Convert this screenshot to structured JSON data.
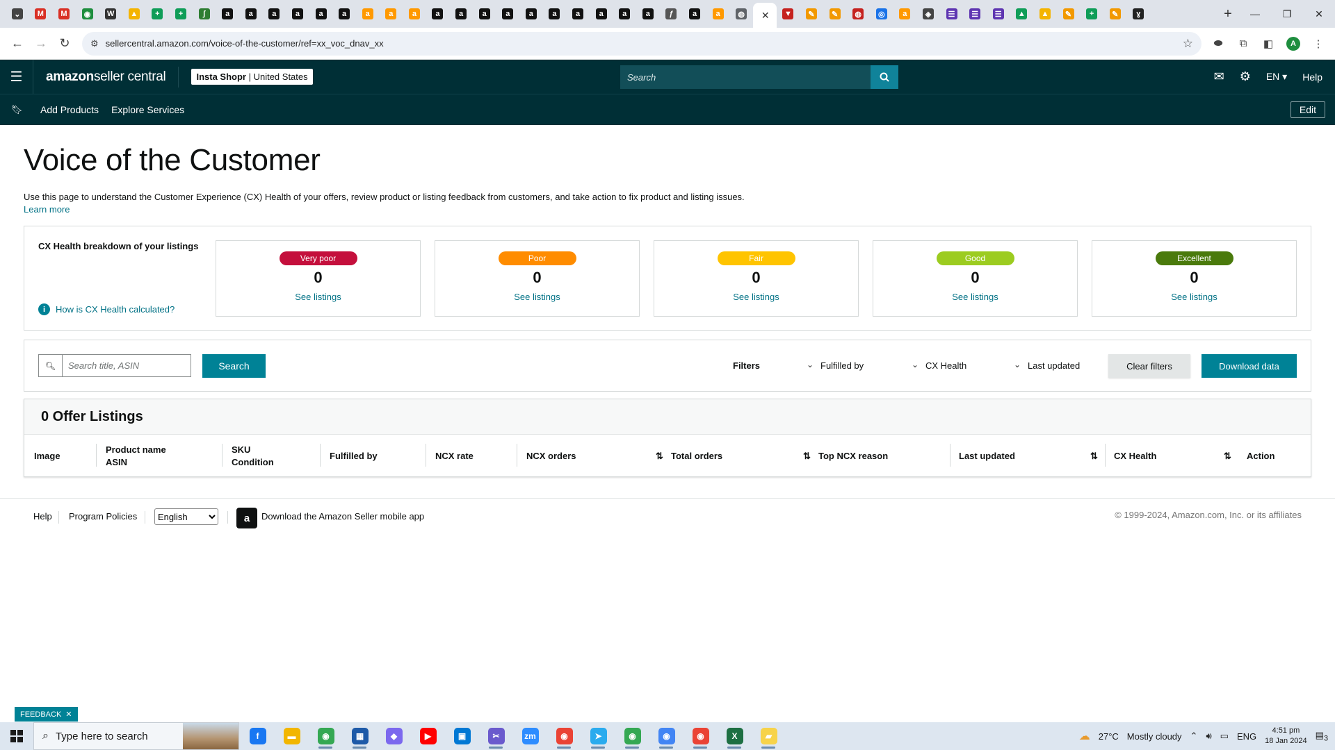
{
  "browser": {
    "tab_favicons": [
      {
        "icon": "chevron-down-icon",
        "glyph": "⌄",
        "color": "#444444"
      },
      {
        "icon": "gmail-icon",
        "glyph": "M",
        "color": "#d93025"
      },
      {
        "icon": "gmail-icon",
        "glyph": "M",
        "color": "#d93025"
      },
      {
        "icon": "app-icon",
        "glyph": "◉",
        "color": "#1e8e3e"
      },
      {
        "icon": "wix-icon",
        "glyph": "W",
        "color": "#333333"
      },
      {
        "icon": "drive-icon",
        "glyph": "▲",
        "color": "#f4b400"
      },
      {
        "icon": "sheets-icon",
        "glyph": "+",
        "color": "#0f9d58"
      },
      {
        "icon": "sheets-icon",
        "glyph": "+",
        "color": "#0f9d58"
      },
      {
        "icon": "app-icon",
        "glyph": "ʃ",
        "color": "#2e7d32"
      },
      {
        "icon": "amazon-icon",
        "glyph": "a",
        "color": "#111111"
      },
      {
        "icon": "amazon-icon",
        "glyph": "a",
        "color": "#111111"
      },
      {
        "icon": "amazon-icon",
        "glyph": "a",
        "color": "#111111"
      },
      {
        "icon": "amazon-icon",
        "glyph": "a",
        "color": "#111111"
      },
      {
        "icon": "amazon-icon",
        "glyph": "a",
        "color": "#111111"
      },
      {
        "icon": "amazon-icon",
        "glyph": "a",
        "color": "#111111"
      },
      {
        "icon": "amazon-smile-icon",
        "glyph": "a",
        "color": "#ff9900"
      },
      {
        "icon": "amazon-smile-icon",
        "glyph": "a",
        "color": "#ff9900"
      },
      {
        "icon": "amazon-smile-icon",
        "glyph": "a",
        "color": "#ff9900"
      },
      {
        "icon": "amazon-icon",
        "glyph": "a",
        "color": "#111111"
      },
      {
        "icon": "amazon-icon",
        "glyph": "a",
        "color": "#111111"
      },
      {
        "icon": "amazon-icon",
        "glyph": "a",
        "color": "#111111"
      },
      {
        "icon": "amazon-icon",
        "glyph": "a",
        "color": "#111111"
      },
      {
        "icon": "amazon-icon",
        "glyph": "a",
        "color": "#111111"
      },
      {
        "icon": "amazon-icon",
        "glyph": "a",
        "color": "#111111"
      },
      {
        "icon": "amazon-icon",
        "glyph": "a",
        "color": "#111111"
      },
      {
        "icon": "amazon-icon",
        "glyph": "a",
        "color": "#111111"
      },
      {
        "icon": "amazon-icon",
        "glyph": "a",
        "color": "#111111"
      },
      {
        "icon": "amazon-icon",
        "glyph": "a",
        "color": "#111111"
      },
      {
        "icon": "app-icon",
        "glyph": "ƒ",
        "color": "#555555"
      },
      {
        "icon": "amazon-icon",
        "glyph": "a",
        "color": "#111111"
      },
      {
        "icon": "amazon-smile-icon",
        "glyph": "a",
        "color": "#ff9900"
      },
      {
        "icon": "globe-icon",
        "glyph": "◍",
        "color": "#5f6368"
      }
    ],
    "tab_favicons_after": [
      {
        "icon": "app-icon",
        "glyph": "▼",
        "color": "#c5221f"
      },
      {
        "icon": "pen-icon",
        "glyph": "✎",
        "color": "#f29900"
      },
      {
        "icon": "pen-icon",
        "glyph": "✎",
        "color": "#f29900"
      },
      {
        "icon": "app-icon",
        "glyph": "◍",
        "color": "#c5221f"
      },
      {
        "icon": "app-icon",
        "glyph": "◎",
        "color": "#1a73e8"
      },
      {
        "icon": "amazon-smile-icon",
        "glyph": "a",
        "color": "#ff9900"
      },
      {
        "icon": "app-icon",
        "glyph": "◈",
        "color": "#444444"
      },
      {
        "icon": "form-icon",
        "glyph": "☰",
        "color": "#5e35b1"
      },
      {
        "icon": "form-icon",
        "glyph": "☰",
        "color": "#5e35b1"
      },
      {
        "icon": "form-icon",
        "glyph": "☰",
        "color": "#5e35b1"
      },
      {
        "icon": "drive-icon",
        "glyph": "▲",
        "color": "#0f9d58"
      },
      {
        "icon": "drive-icon",
        "glyph": "▲",
        "color": "#f4b400"
      },
      {
        "icon": "pen-icon",
        "glyph": "✎",
        "color": "#f29900"
      },
      {
        "icon": "sheets-icon",
        "glyph": "+",
        "color": "#0f9d58"
      },
      {
        "icon": "pen-icon",
        "glyph": "✎",
        "color": "#f29900"
      },
      {
        "icon": "app-icon",
        "glyph": "ɣ",
        "color": "#222222"
      }
    ],
    "url": "sellercentral.amazon.com/voice-of-the-customer/ref=xx_voc_dnav_xx",
    "profile_initial": "A"
  },
  "header": {
    "brand_main": "amazon",
    "brand_sub": " seller central",
    "store_name": "Insta Shopr",
    "store_region": " | United States",
    "search_placeholder": "Search",
    "language": "EN",
    "help": "Help"
  },
  "subnav": {
    "items": [
      "Add Products",
      "Explore Services"
    ],
    "edit": "Edit"
  },
  "page": {
    "title": "Voice of the Customer",
    "intro": "Use this page to understand the Customer Experience (CX) Health of your offers, review product or listing feedback from customers, and take action to fix product and listing issues.",
    "learn_more": "Learn more"
  },
  "cx_health": {
    "title": "CX Health breakdown of your listings",
    "how_link": "How is CX Health calculated?",
    "cards": [
      {
        "label": "Very poor",
        "count": "0",
        "link": "See listings",
        "color": "#c40f3c"
      },
      {
        "label": "Poor",
        "count": "0",
        "link": "See listings",
        "color": "#ff8c00"
      },
      {
        "label": "Fair",
        "count": "0",
        "link": "See listings",
        "color": "#ffc400"
      },
      {
        "label": "Good",
        "count": "0",
        "link": "See listings",
        "color": "#9ccc20"
      },
      {
        "label": "Excellent",
        "count": "0",
        "link": "See listings",
        "color": "#4a7a0c"
      }
    ]
  },
  "filters": {
    "search_placeholder": "Search title, ASIN",
    "search_button": "Search",
    "filters_label": "Filters",
    "fulfilled_by": "Fulfilled by",
    "cx_health": "CX Health",
    "last_updated": "Last updated",
    "clear": "Clear filters",
    "download": "Download data"
  },
  "listings": {
    "heading": "0 Offer Listings",
    "columns": [
      {
        "line1": "Image",
        "line2": ""
      },
      {
        "line1": "Product name",
        "line2": "ASIN"
      },
      {
        "line1": "SKU",
        "line2": "Condition"
      },
      {
        "line1": "Fulfilled by",
        "line2": ""
      },
      {
        "line1": "NCX rate",
        "line2": ""
      },
      {
        "line1": "NCX orders",
        "line2": ""
      },
      {
        "line1": "Total orders",
        "line2": ""
      },
      {
        "line1": "Top NCX reason",
        "line2": ""
      },
      {
        "line1": "Last updated",
        "line2": ""
      },
      {
        "line1": "CX Health",
        "line2": ""
      },
      {
        "line1": "Action",
        "line2": ""
      }
    ]
  },
  "footer": {
    "help": "Help",
    "policies": "Program Policies",
    "language_selected": "English",
    "app_promo": "Download the Amazon Seller mobile app",
    "copyright": "© 1999-2024, Amazon.com, Inc. or its affiliates"
  },
  "feedback": "FEEDBACK",
  "taskbar": {
    "search_placeholder": "Type here to search",
    "apps": [
      {
        "icon": "facebook-icon",
        "glyph": "f",
        "color": "#1877f2",
        "open": false
      },
      {
        "icon": "file-explorer-icon",
        "glyph": "▬",
        "color": "#f2b600",
        "open": false
      },
      {
        "icon": "chrome-icon",
        "glyph": "◉",
        "color": "#34a853",
        "open": true
      },
      {
        "icon": "calculator-icon",
        "glyph": "▦",
        "color": "#1e5aa8",
        "open": true
      },
      {
        "icon": "app-icon",
        "glyph": "◆",
        "color": "#7b68ee",
        "open": false
      },
      {
        "icon": "youtube-icon",
        "glyph": "▶",
        "color": "#ff0000",
        "open": false
      },
      {
        "icon": "store-icon",
        "glyph": "▣",
        "color": "#0078d4",
        "open": false
      },
      {
        "icon": "snipping-tool-icon",
        "glyph": "✂",
        "color": "#6a5acd",
        "open": true
      },
      {
        "icon": "zoom-icon",
        "glyph": "zm",
        "color": "#2d8cff",
        "open": false
      },
      {
        "icon": "chrome-icon",
        "glyph": "◉",
        "color": "#ea4335",
        "open": true
      },
      {
        "icon": "telegram-icon",
        "glyph": "➤",
        "color": "#2aabee",
        "open": true
      },
      {
        "icon": "chrome-icon",
        "glyph": "◉",
        "color": "#34a853",
        "open": true
      },
      {
        "icon": "chrome-icon",
        "glyph": "◉",
        "color": "#4285f4",
        "open": true
      },
      {
        "icon": "chrome-icon",
        "glyph": "◉",
        "color": "#ea4335",
        "open": true
      },
      {
        "icon": "excel-icon",
        "glyph": "X",
        "color": "#1d6f42",
        "open": true
      },
      {
        "icon": "sticky-notes-icon",
        "glyph": "▰",
        "color": "#f7d34a",
        "open": true
      }
    ],
    "temperature": "27°C",
    "weather": "Mostly cloudy",
    "lang": "ENG",
    "time": "4:51 pm",
    "date": "18 Jan 2024",
    "notifications": "3"
  }
}
